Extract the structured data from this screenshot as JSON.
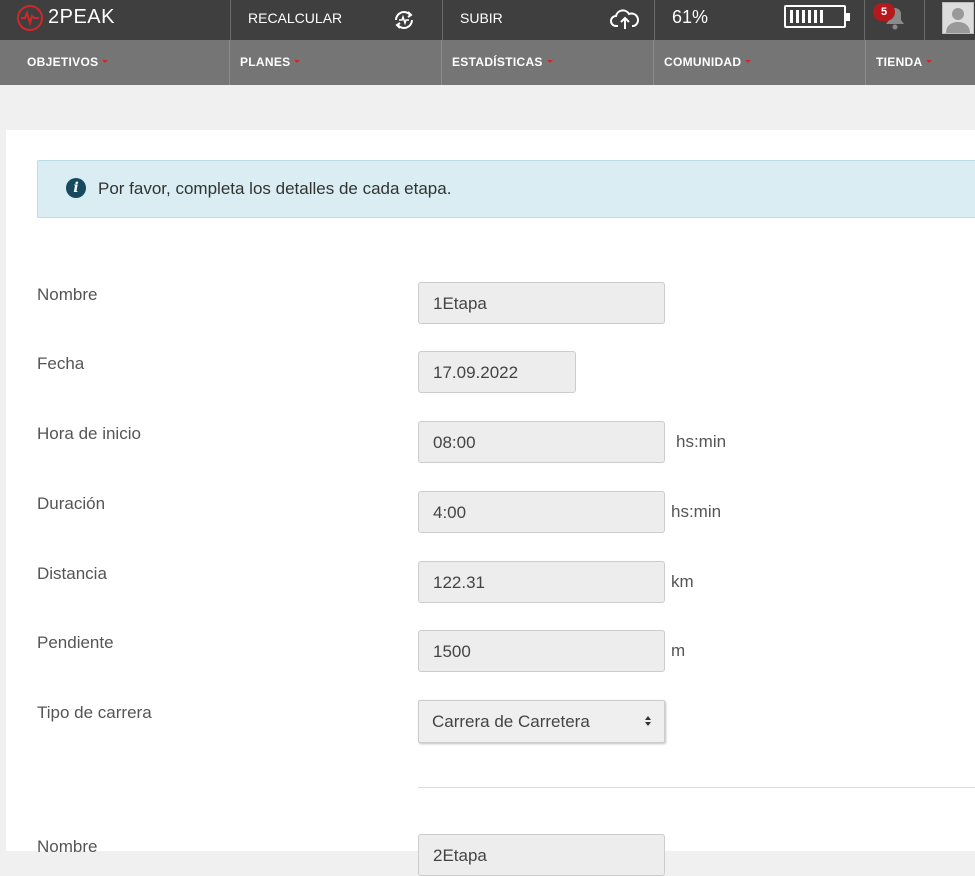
{
  "header": {
    "logo_text": "2PEAK",
    "recalc_label": "RECALCULAR",
    "upload_label": "SUBIR",
    "battery_percent": "61%",
    "notifications_count": "5"
  },
  "nav": {
    "items": [
      {
        "label": "OBJETIVOS"
      },
      {
        "label": "PLANES"
      },
      {
        "label": "ESTADÍSTICAS"
      },
      {
        "label": "COMUNIDAD"
      },
      {
        "label": "TIENDA"
      }
    ]
  },
  "alert": {
    "icon": "info-icon",
    "text": "Por favor, completa los detalles de cada etapa."
  },
  "form": {
    "name": {
      "label": "Nombre",
      "value": "1Etapa"
    },
    "date": {
      "label": "Fecha",
      "value": "17.09.2022"
    },
    "start": {
      "label": "Hora de inicio",
      "value": "08:00",
      "unit": "hs:min"
    },
    "duration": {
      "label": "Duración",
      "value": "4:00",
      "unit": "hs:min"
    },
    "distance": {
      "label": "Distancia",
      "value": "122.31",
      "unit": "km"
    },
    "slope": {
      "label": "Pendiente",
      "value": "1500",
      "unit": "m"
    },
    "race_type": {
      "label": "Tipo de carrera",
      "value": "Carrera de Carretera"
    }
  },
  "form2": {
    "name": {
      "label": "Nombre",
      "value": "2Etapa"
    }
  },
  "colors": {
    "topbar": "#3f3f3f",
    "navbar": "#757575",
    "accent": "#d0272a",
    "alert_bg": "#d9edf2"
  }
}
